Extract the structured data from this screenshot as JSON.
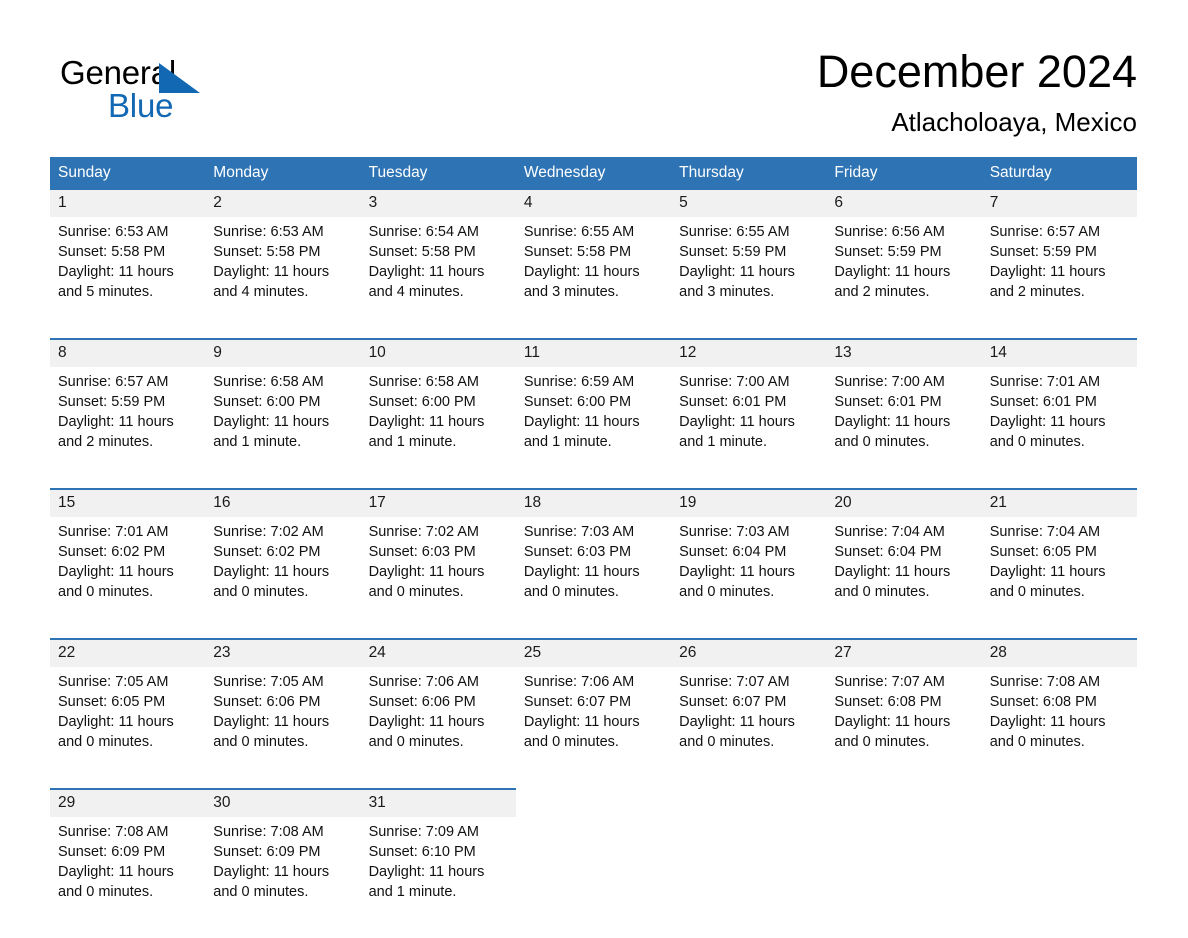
{
  "brand": {
    "name_part1": "General",
    "name_part2": "Blue",
    "triangle_color": "#1268b3"
  },
  "header": {
    "title": "December 2024",
    "location": "Atlacholoaya, Mexico"
  },
  "theme": {
    "header_blue": "#2e74b5",
    "daynum_band": "#f1f1f1",
    "text": "#000000"
  },
  "weekdays": [
    "Sunday",
    "Monday",
    "Tuesday",
    "Wednesday",
    "Thursday",
    "Friday",
    "Saturday"
  ],
  "weeks": [
    {
      "days": [
        {
          "num": "1",
          "sunrise": "Sunrise: 6:53 AM",
          "sunset": "Sunset: 5:58 PM",
          "daylight": "Daylight: 11 hours and 5 minutes."
        },
        {
          "num": "2",
          "sunrise": "Sunrise: 6:53 AM",
          "sunset": "Sunset: 5:58 PM",
          "daylight": "Daylight: 11 hours and 4 minutes."
        },
        {
          "num": "3",
          "sunrise": "Sunrise: 6:54 AM",
          "sunset": "Sunset: 5:58 PM",
          "daylight": "Daylight: 11 hours and 4 minutes."
        },
        {
          "num": "4",
          "sunrise": "Sunrise: 6:55 AM",
          "sunset": "Sunset: 5:58 PM",
          "daylight": "Daylight: 11 hours and 3 minutes."
        },
        {
          "num": "5",
          "sunrise": "Sunrise: 6:55 AM",
          "sunset": "Sunset: 5:59 PM",
          "daylight": "Daylight: 11 hours and 3 minutes."
        },
        {
          "num": "6",
          "sunrise": "Sunrise: 6:56 AM",
          "sunset": "Sunset: 5:59 PM",
          "daylight": "Daylight: 11 hours and 2 minutes."
        },
        {
          "num": "7",
          "sunrise": "Sunrise: 6:57 AM",
          "sunset": "Sunset: 5:59 PM",
          "daylight": "Daylight: 11 hours and 2 minutes."
        }
      ]
    },
    {
      "days": [
        {
          "num": "8",
          "sunrise": "Sunrise: 6:57 AM",
          "sunset": "Sunset: 5:59 PM",
          "daylight": "Daylight: 11 hours and 2 minutes."
        },
        {
          "num": "9",
          "sunrise": "Sunrise: 6:58 AM",
          "sunset": "Sunset: 6:00 PM",
          "daylight": "Daylight: 11 hours and 1 minute."
        },
        {
          "num": "10",
          "sunrise": "Sunrise: 6:58 AM",
          "sunset": "Sunset: 6:00 PM",
          "daylight": "Daylight: 11 hours and 1 minute."
        },
        {
          "num": "11",
          "sunrise": "Sunrise: 6:59 AM",
          "sunset": "Sunset: 6:00 PM",
          "daylight": "Daylight: 11 hours and 1 minute."
        },
        {
          "num": "12",
          "sunrise": "Sunrise: 7:00 AM",
          "sunset": "Sunset: 6:01 PM",
          "daylight": "Daylight: 11 hours and 1 minute."
        },
        {
          "num": "13",
          "sunrise": "Sunrise: 7:00 AM",
          "sunset": "Sunset: 6:01 PM",
          "daylight": "Daylight: 11 hours and 0 minutes."
        },
        {
          "num": "14",
          "sunrise": "Sunrise: 7:01 AM",
          "sunset": "Sunset: 6:01 PM",
          "daylight": "Daylight: 11 hours and 0 minutes."
        }
      ]
    },
    {
      "days": [
        {
          "num": "15",
          "sunrise": "Sunrise: 7:01 AM",
          "sunset": "Sunset: 6:02 PM",
          "daylight": "Daylight: 11 hours and 0 minutes."
        },
        {
          "num": "16",
          "sunrise": "Sunrise: 7:02 AM",
          "sunset": "Sunset: 6:02 PM",
          "daylight": "Daylight: 11 hours and 0 minutes."
        },
        {
          "num": "17",
          "sunrise": "Sunrise: 7:02 AM",
          "sunset": "Sunset: 6:03 PM",
          "daylight": "Daylight: 11 hours and 0 minutes."
        },
        {
          "num": "18",
          "sunrise": "Sunrise: 7:03 AM",
          "sunset": "Sunset: 6:03 PM",
          "daylight": "Daylight: 11 hours and 0 minutes."
        },
        {
          "num": "19",
          "sunrise": "Sunrise: 7:03 AM",
          "sunset": "Sunset: 6:04 PM",
          "daylight": "Daylight: 11 hours and 0 minutes."
        },
        {
          "num": "20",
          "sunrise": "Sunrise: 7:04 AM",
          "sunset": "Sunset: 6:04 PM",
          "daylight": "Daylight: 11 hours and 0 minutes."
        },
        {
          "num": "21",
          "sunrise": "Sunrise: 7:04 AM",
          "sunset": "Sunset: 6:05 PM",
          "daylight": "Daylight: 11 hours and 0 minutes."
        }
      ]
    },
    {
      "days": [
        {
          "num": "22",
          "sunrise": "Sunrise: 7:05 AM",
          "sunset": "Sunset: 6:05 PM",
          "daylight": "Daylight: 11 hours and 0 minutes."
        },
        {
          "num": "23",
          "sunrise": "Sunrise: 7:05 AM",
          "sunset": "Sunset: 6:06 PM",
          "daylight": "Daylight: 11 hours and 0 minutes."
        },
        {
          "num": "24",
          "sunrise": "Sunrise: 7:06 AM",
          "sunset": "Sunset: 6:06 PM",
          "daylight": "Daylight: 11 hours and 0 minutes."
        },
        {
          "num": "25",
          "sunrise": "Sunrise: 7:06 AM",
          "sunset": "Sunset: 6:07 PM",
          "daylight": "Daylight: 11 hours and 0 minutes."
        },
        {
          "num": "26",
          "sunrise": "Sunrise: 7:07 AM",
          "sunset": "Sunset: 6:07 PM",
          "daylight": "Daylight: 11 hours and 0 minutes."
        },
        {
          "num": "27",
          "sunrise": "Sunrise: 7:07 AM",
          "sunset": "Sunset: 6:08 PM",
          "daylight": "Daylight: 11 hours and 0 minutes."
        },
        {
          "num": "28",
          "sunrise": "Sunrise: 7:08 AM",
          "sunset": "Sunset: 6:08 PM",
          "daylight": "Daylight: 11 hours and 0 minutes."
        }
      ]
    },
    {
      "days": [
        {
          "num": "29",
          "sunrise": "Sunrise: 7:08 AM",
          "sunset": "Sunset: 6:09 PM",
          "daylight": "Daylight: 11 hours and 0 minutes."
        },
        {
          "num": "30",
          "sunrise": "Sunrise: 7:08 AM",
          "sunset": "Sunset: 6:09 PM",
          "daylight": "Daylight: 11 hours and 0 minutes."
        },
        {
          "num": "31",
          "sunrise": "Sunrise: 7:09 AM",
          "sunset": "Sunset: 6:10 PM",
          "daylight": "Daylight: 11 hours and 1 minute."
        },
        {
          "num": "",
          "sunrise": "",
          "sunset": "",
          "daylight": ""
        },
        {
          "num": "",
          "sunrise": "",
          "sunset": "",
          "daylight": ""
        },
        {
          "num": "",
          "sunrise": "",
          "sunset": "",
          "daylight": ""
        },
        {
          "num": "",
          "sunrise": "",
          "sunset": "",
          "daylight": ""
        }
      ]
    }
  ]
}
